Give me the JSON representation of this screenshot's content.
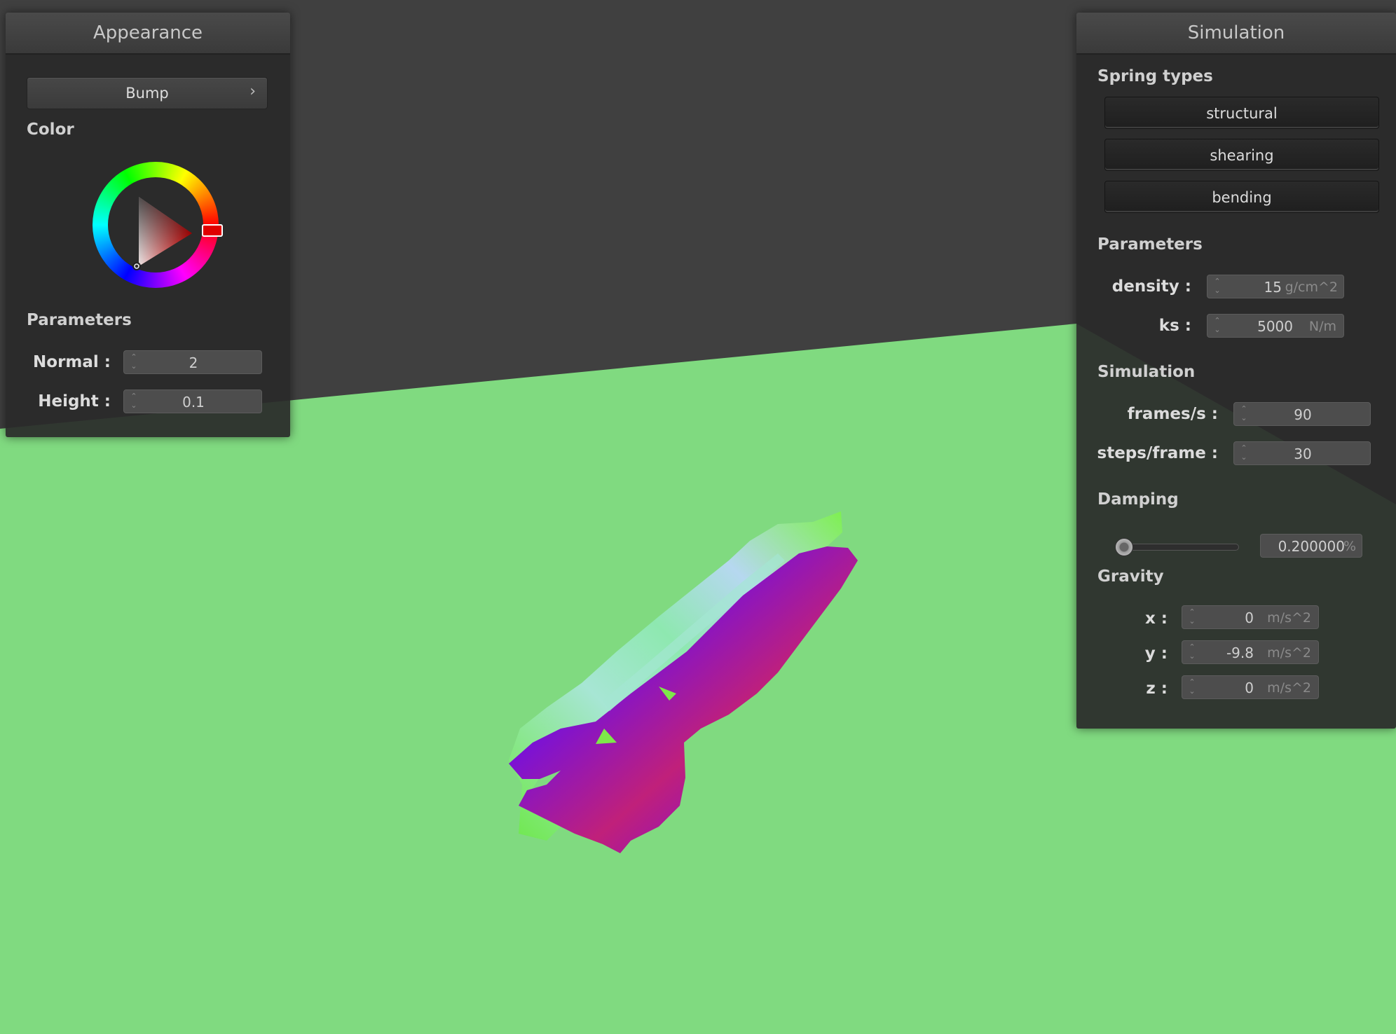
{
  "appearance_panel": {
    "title": "Appearance",
    "shader_combo": {
      "selected": "Bump",
      "arrow_icon": "chevron-right-icon",
      "arrow_glyph": "›"
    },
    "color_section": {
      "title": "Color",
      "selected_color": "#e00000",
      "picker_icon": "color-wheel-icon"
    },
    "parameters": {
      "title": "Parameters",
      "normal": {
        "label": "Normal :",
        "value": "2"
      },
      "height": {
        "label": "Height :",
        "value": "0.1"
      }
    }
  },
  "simulation_panel": {
    "title": "Simulation",
    "spring_types": {
      "title": "Spring types",
      "buttons": [
        "structural",
        "shearing",
        "bending"
      ]
    },
    "parameters": {
      "title": "Parameters",
      "density": {
        "label": "density :",
        "value": "15",
        "unit": "g/cm^2"
      },
      "ks": {
        "label": "ks :",
        "value": "5000",
        "unit": "N/m"
      }
    },
    "simulation": {
      "title": "Simulation",
      "fps": {
        "label": "frames/s :",
        "value": "90"
      },
      "steps": {
        "label": "steps/frame :",
        "value": "30"
      }
    },
    "damping": {
      "title": "Damping",
      "value": "0.200000",
      "unit": "%",
      "slider_level": 0.2
    },
    "gravity": {
      "title": "Gravity",
      "x": {
        "label": "x :",
        "value": "0",
        "unit": "m/s^2"
      },
      "y": {
        "label": "y :",
        "value": "-9.8",
        "unit": "m/s^2"
      },
      "z": {
        "label": "z :",
        "value": "0",
        "unit": "m/s^2"
      }
    }
  },
  "scene": {
    "background_color": "#404040",
    "ground_color": "#80da80",
    "cloth_colors": [
      "#8a10c8",
      "#7ee84a",
      "#9fe0d8"
    ]
  },
  "spinner_icon": "spinner-arrows-icon",
  "spinner_up": "⌃",
  "spinner_down": "⌄"
}
